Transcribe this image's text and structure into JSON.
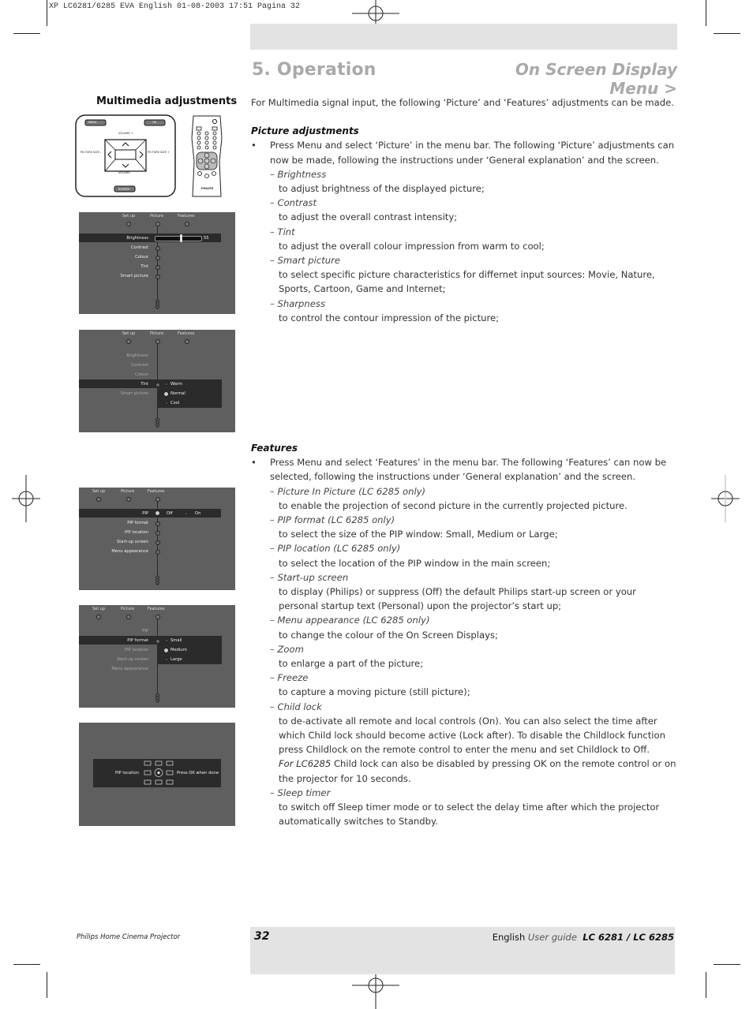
{
  "print_slug": "XP LC6281/6285 EVA English  01-08-2003  17:51  Pagina 32",
  "header": {
    "section_title": "5. Operation",
    "subsection_title": "On Screen Display Menu >"
  },
  "sidebar": {
    "heading": "Multimedia adjustments",
    "keypad": {
      "menu_label": "MENU",
      "ok_label": "OK",
      "volume_up": "VOLUME +",
      "volume_down": "VOLUME -",
      "picture_size_minus": "PICTURE SIZE -",
      "picture_size_plus": "PICTURE SIZE +",
      "source_label": "SOURCE"
    },
    "remote_brand": "PHILIPS"
  },
  "osd_screens": [
    {
      "tabs": [
        "Set up",
        "Picture",
        "Features"
      ],
      "items": [
        "Brightness",
        "Contrast",
        "Colour",
        "Tint",
        "Smart picture"
      ],
      "highlighted": "Brightness",
      "slider_value": "55",
      "slider_fraction": 0.55
    },
    {
      "tabs": [
        "Set up",
        "Picture",
        "Features"
      ],
      "items": [
        "Brightness",
        "Contrast",
        "Colour",
        "Tint",
        "Smart picture"
      ],
      "highlighted": "Tint",
      "options": [
        "Warm",
        "Normal",
        "Cool"
      ],
      "selected_option": "Normal"
    },
    {
      "tabs": [
        "Set up",
        "Picture",
        "Features"
      ],
      "items": [
        "PIP",
        "PIP format",
        "PIP location",
        "Start-up screen",
        "Menu appearance"
      ],
      "highlighted": "PIP",
      "options": [
        "Off",
        "On"
      ],
      "selected_option": "Off"
    },
    {
      "tabs": [
        "Set up",
        "Picture",
        "Features"
      ],
      "items": [
        "PIP",
        "PIP format",
        "PIP location",
        "Start-up screen",
        "Menu appearance"
      ],
      "highlighted": "PIP format",
      "options": [
        "Small",
        "Medium",
        "Large"
      ],
      "selected_option": "Medium"
    },
    {
      "label": "PIP location",
      "hint": "Press OK when done"
    }
  ],
  "content": {
    "intro": "For Multimedia signal input, the following ‘Picture’ and ‘Features’ adjustments can be made.",
    "picture": {
      "heading": "Picture adjustments",
      "bullet": "•",
      "lead": "Press Menu and select ‘Picture’ in the menu bar.  The following ‘Picture’ adjustments can now be made, following the instructions under ‘General explanation’ and the screen.",
      "items": [
        {
          "name": "– Brightness",
          "desc": "to adjust brightness of the displayed picture;"
        },
        {
          "name": "– Contrast",
          "desc": "to adjust the overall contrast intensity;"
        },
        {
          "name": "– Tint",
          "desc": "to adjust the overall colour impression from warm to cool;"
        },
        {
          "name": "– Smart picture",
          "desc": "to select specific picture characteristics for differnet input sources: Movie, Nature, Sports, Cartoon, Game and Internet;"
        },
        {
          "name": "– Sharpness",
          "desc": "to control the contour impression of the picture;"
        }
      ]
    },
    "features": {
      "heading": "Features",
      "bullet": "•",
      "lead": "Press Menu and select ‘Features’ in the menu bar.  The following ‘Features’ can now be selected, following the instructions under ‘General explanation’ and the screen.",
      "items": [
        {
          "name": "– Picture In Picture (LC 6285 only)",
          "desc": "to enable the projection of second picture in the currently projected picture."
        },
        {
          "name": "– PIP format (LC 6285 only)",
          "desc": "to select the size of the PIP window: Small, Medium or Large;"
        },
        {
          "name": "– PIP location (LC 6285 only)",
          "desc": "to select the location of the PIP window in the main screen;"
        },
        {
          "name": "– Start-up screen",
          "desc": "to display (Philips) or suppress (Off) the default Philips start-up screen or your personal startup text (Personal) upon the projector’s start up;"
        },
        {
          "name": "– Menu appearance (LC 6285 only)",
          "desc": "to change the colour of the On Screen Displays;"
        },
        {
          "name": "– Zoom",
          "desc": "to enlarge a part of the picture;"
        },
        {
          "name": "– Freeze",
          "desc": "to capture a moving picture (still picture);"
        },
        {
          "name": "– Child lock",
          "desc": "to de-activate all remote and local controls (On). You can also select the time after which Child lock should become active (Lock after). To disable the Childlock function press Childlock on the remote control to enter the menu and set Childlock to Off.",
          "note_prefix": "For LC6285",
          "note": " Child lock can also be disabled by pressing OK on the remote control or on the projector for 10 seconds."
        },
        {
          "name": "– Sleep timer",
          "desc": "to switch off Sleep timer mode or to select the delay time after which the projector automatically switches to Standby."
        }
      ]
    }
  },
  "footer": {
    "product": "Philips Home Cinema Projector",
    "page_number": "32",
    "language": "English",
    "guide": "User guide",
    "models": "LC 6281 / LC 6285"
  }
}
